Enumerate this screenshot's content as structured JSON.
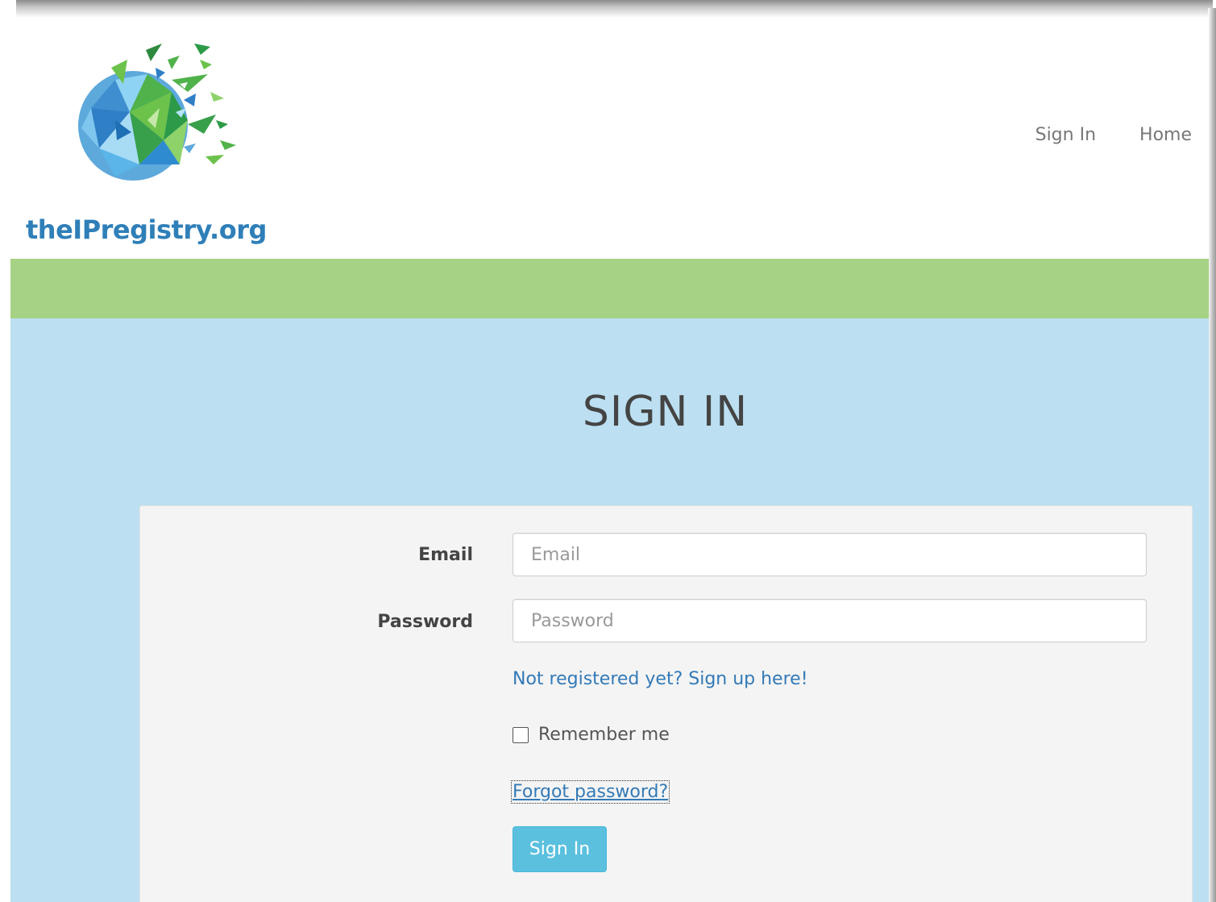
{
  "brand": {
    "logo_text": "theIPregistry.org",
    "logo_icon": "fragmented-globe-logo"
  },
  "nav": {
    "items": [
      {
        "label": "Sign In"
      },
      {
        "label": "Home"
      }
    ]
  },
  "main": {
    "title": "SIGN IN"
  },
  "form": {
    "email_label": "Email",
    "email_placeholder": "Email",
    "email_value": "",
    "password_label": "Password",
    "password_placeholder": "Password",
    "password_value": "",
    "signup_link": "Not registered yet? Sign up here!",
    "remember_label": "Remember me",
    "remember_checked": false,
    "forgot_link": "Forgot password?",
    "submit_label": "Sign In"
  },
  "colors": {
    "green_band": "#a6d285",
    "blue_background": "#bcdff1",
    "link": "#337ab7",
    "button": "#5bc0de",
    "logo_text": "#2f7fb8"
  }
}
